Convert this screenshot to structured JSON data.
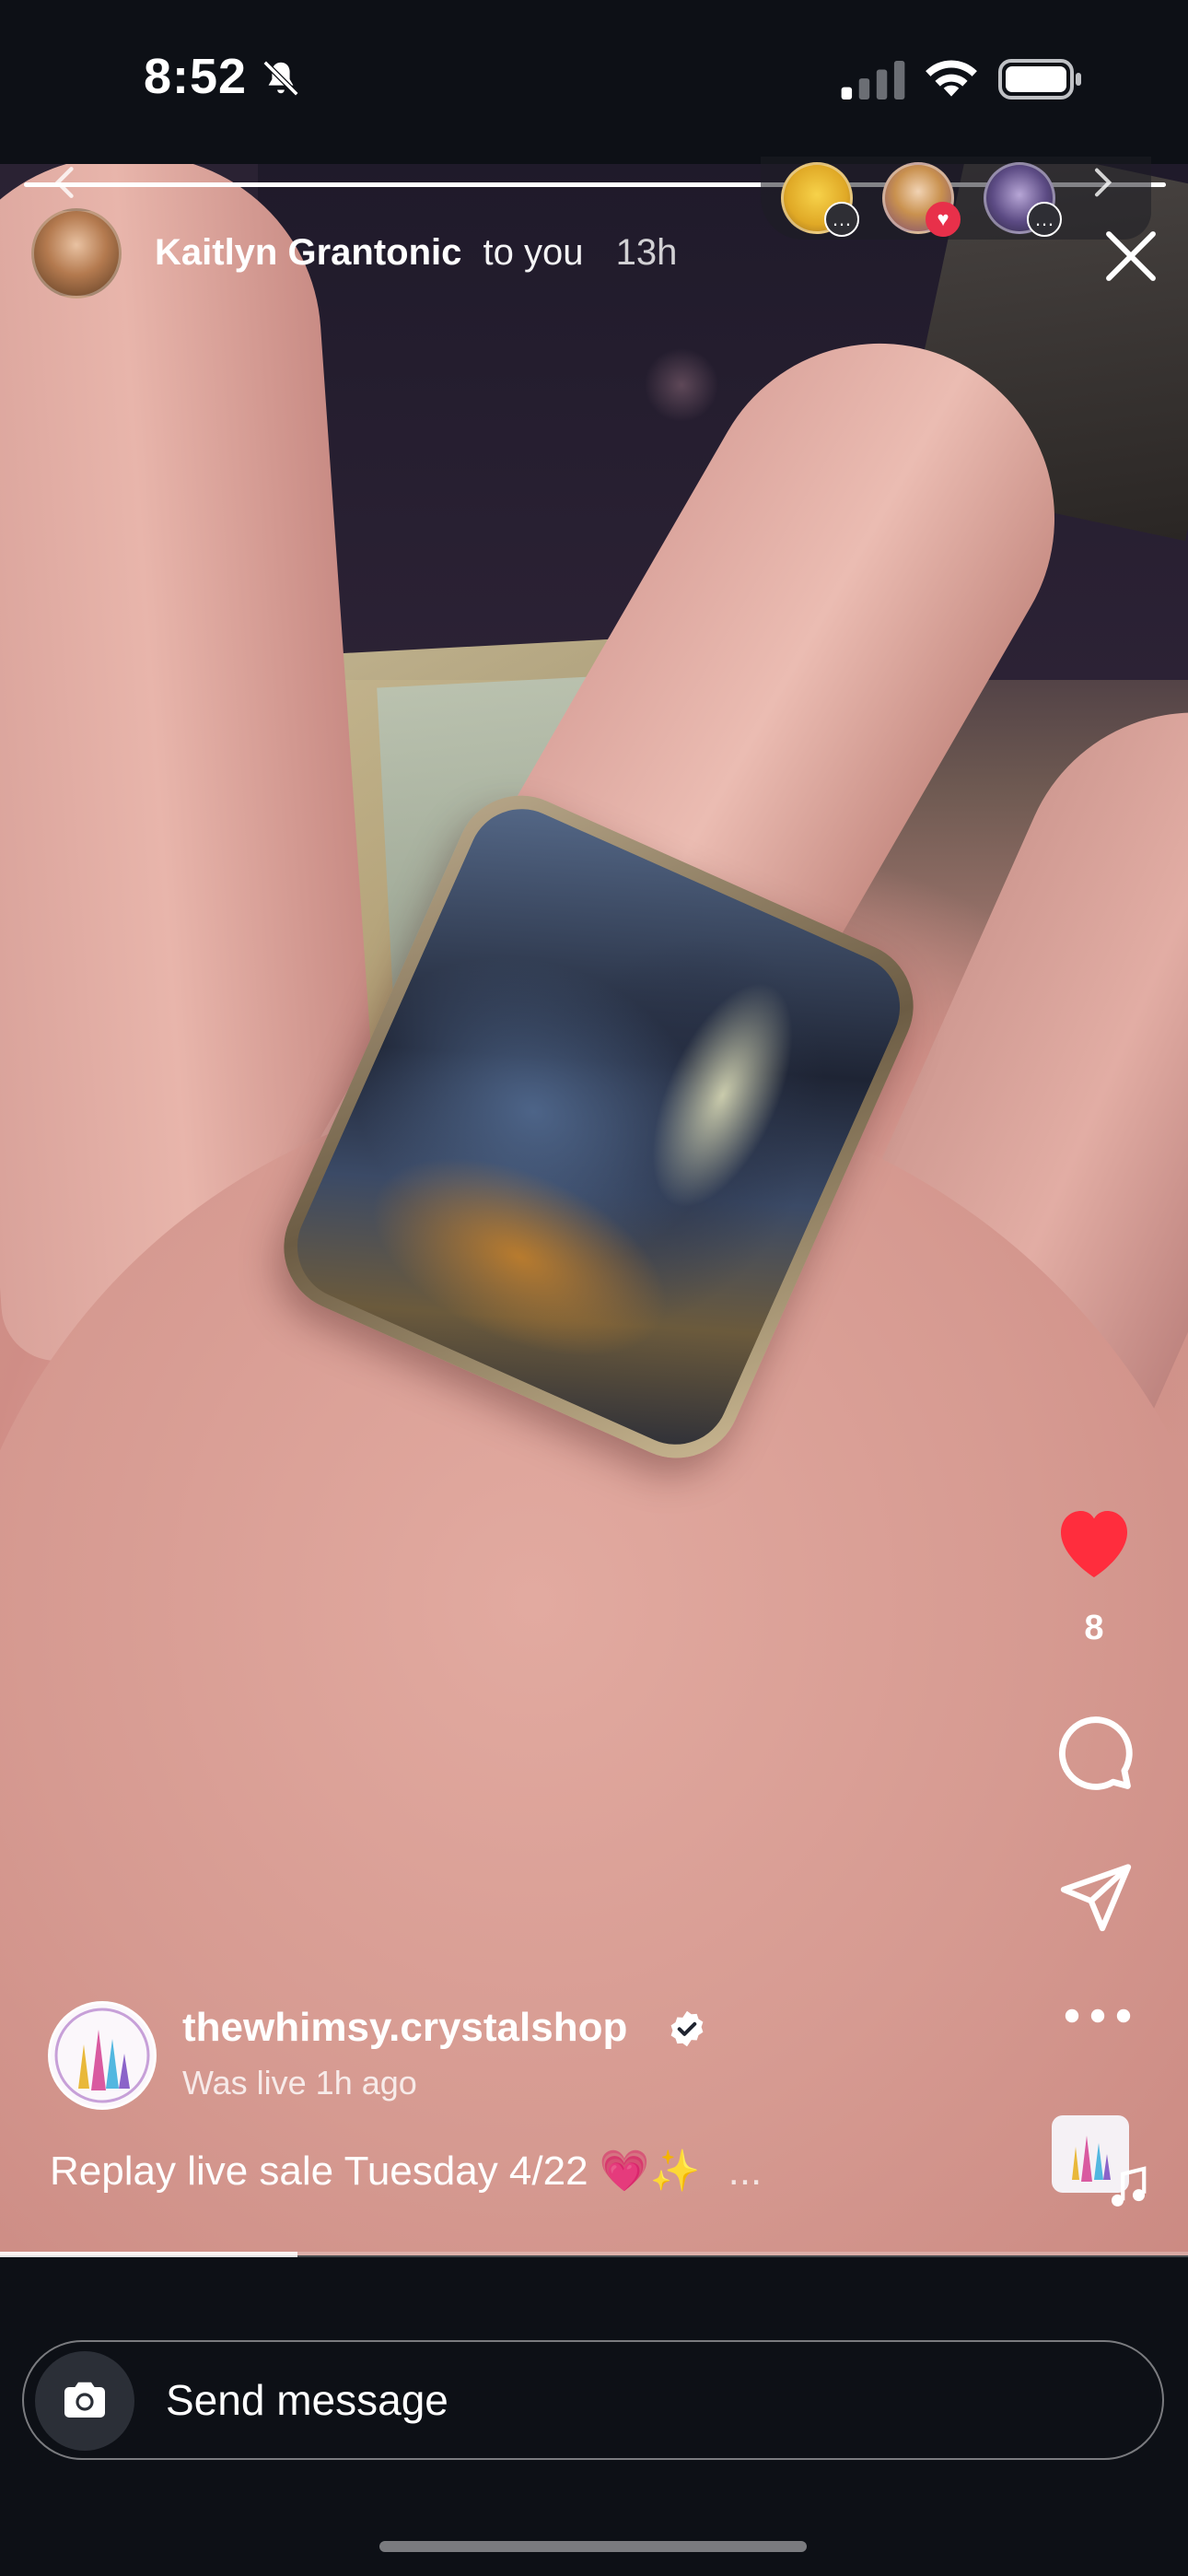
{
  "status_bar": {
    "time": "8:52",
    "icons": [
      "bell-slash-icon",
      "signal-icon",
      "wifi-icon",
      "battery-icon"
    ]
  },
  "story_header": {
    "username": "Kaitlyn Grantonic",
    "recipient_text": "to you",
    "timestamp": "13h",
    "close_icon": "close-icon"
  },
  "live_strip": {
    "avatars": [
      {
        "name": "live-avatar-1",
        "badge": "comment"
      },
      {
        "name": "live-avatar-2",
        "badge": "heart"
      },
      {
        "name": "live-avatar-3",
        "badge": "comment"
      }
    ]
  },
  "right_rail": {
    "like_count": "8",
    "icons": [
      "heart-icon",
      "comment-icon",
      "share-icon",
      "more-icon",
      "audio-icon"
    ]
  },
  "post": {
    "account": "thewhimsy.crystalshop",
    "subtitle": "Was live 1h ago",
    "caption": "Replay live sale Tuesday 4/22 💗✨",
    "caption_more": "...",
    "verified": true
  },
  "playback": {
    "progress_fraction": 0.25
  },
  "message_bar": {
    "placeholder": "Send message"
  },
  "colors": {
    "background": "#0d1016",
    "like_red": "#ff2d3d",
    "text": "#ffffff"
  }
}
